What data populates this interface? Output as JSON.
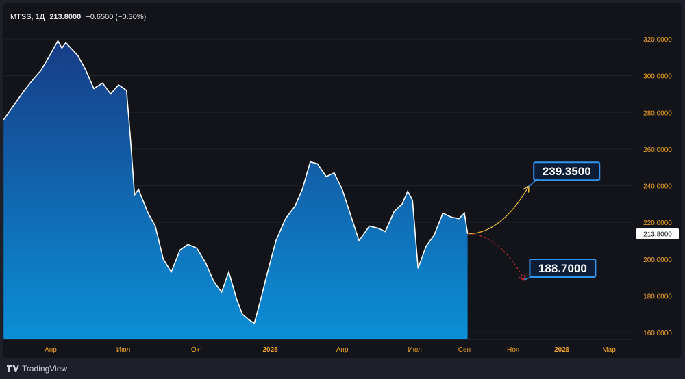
{
  "header": {
    "symbol": "MTSS, 1Д",
    "last": "213.8000",
    "change": "−0.6500 (−0.30%)"
  },
  "footer": {
    "brand": "TradingView",
    "logo_icon": "tradingview-logo-icon"
  },
  "colors": {
    "line": "#ffffff",
    "area_top": "#173c86",
    "area_bottom": "#0b8fd6",
    "label_bg": "#0e1d36",
    "label_border": "#2f95ee",
    "forecast_up": "#f5c431",
    "forecast_down": "#c63030",
    "axis_text": "#f5a623",
    "gridline": "#1f222a"
  },
  "chart_data": {
    "type": "area",
    "y_axis": {
      "min": 160,
      "max": 320,
      "ticks": [
        "320.0000",
        "300.0000",
        "280.0000",
        "260.0000",
        "240.0000",
        "220.0000",
        "200.0000",
        "180.0000",
        "160.0000"
      ],
      "tick_values": [
        320,
        300,
        280,
        260,
        240,
        220,
        200,
        180,
        160
      ]
    },
    "x_axis": {
      "tick_labels": [
        "Апр",
        "Июл",
        "Окт",
        "2025",
        "Апр",
        "Июл",
        "Сен",
        "Ноя",
        "2026",
        "Мар"
      ],
      "tick_dates": [
        "2024-04-01",
        "2024-07-01",
        "2024-10-01",
        "2025-01-01",
        "2025-04-01",
        "2025-07-01",
        "2025-09-01",
        "2025-11-01",
        "2026-01-01",
        "2026-03-01"
      ],
      "range": [
        "2024-02-01",
        "2026-03-31"
      ]
    },
    "series": [
      {
        "x": [
          "2024-02-02",
          "2024-02-15",
          "2024-02-28",
          "2024-03-10",
          "2024-03-20",
          "2024-04-01",
          "2024-04-10",
          "2024-04-15",
          "2024-04-20",
          "2024-05-05",
          "2024-05-15",
          "2024-05-25",
          "2024-06-05",
          "2024-06-15",
          "2024-06-25",
          "2024-07-05",
          "2024-07-10",
          "2024-07-15",
          "2024-07-20",
          "2024-08-01",
          "2024-08-10",
          "2024-08-20",
          "2024-08-30",
          "2024-09-10",
          "2024-09-20",
          "2024-10-01",
          "2024-10-12",
          "2024-10-22",
          "2024-11-01",
          "2024-11-10",
          "2024-11-20",
          "2024-11-27",
          "2024-12-05",
          "2024-12-12",
          "2024-12-20",
          "2024-12-28",
          "2025-01-08",
          "2025-01-20",
          "2025-02-01",
          "2025-02-10",
          "2025-02-20",
          "2025-03-01",
          "2025-03-12",
          "2025-03-22",
          "2025-04-01",
          "2025-04-10",
          "2025-04-22",
          "2025-05-05",
          "2025-05-15",
          "2025-05-25",
          "2025-06-05",
          "2025-06-15",
          "2025-06-22",
          "2025-06-28",
          "2025-07-05",
          "2025-07-15",
          "2025-07-25",
          "2025-08-05",
          "2025-08-15",
          "2025-08-25",
          "2025-09-01",
          "2025-09-05"
        ],
        "values": [
          276,
          284,
          292,
          298,
          303,
          312,
          319,
          315,
          318,
          311,
          303,
          293,
          296,
          290,
          295,
          292,
          265,
          235,
          238,
          225,
          218,
          200,
          193,
          205,
          208,
          206,
          198,
          188,
          182,
          193,
          178,
          170,
          167,
          165,
          178,
          192,
          210,
          222,
          229,
          238,
          253,
          252,
          245,
          247,
          238,
          226,
          210,
          218,
          217,
          215,
          226,
          230,
          237,
          232,
          195,
          207,
          213,
          225,
          223,
          222,
          225,
          213.8
        ]
      }
    ],
    "last_value": 213.8,
    "last_value_label": "213.8000",
    "forecasts": [
      {
        "label": "239.3500",
        "value": 239.35,
        "x": "2025-11-20",
        "color": "#f5c431"
      },
      {
        "label": "188.7000",
        "value": 188.7,
        "x": "2025-11-15",
        "color": "#c63030"
      }
    ]
  }
}
